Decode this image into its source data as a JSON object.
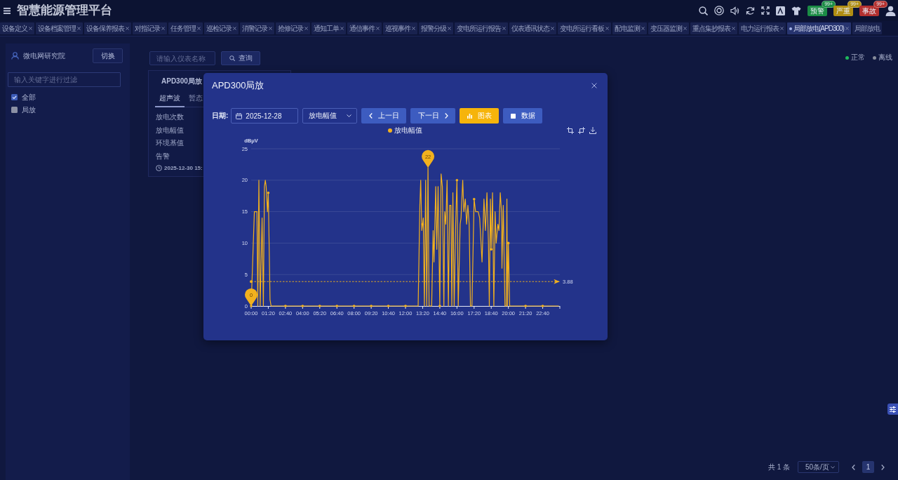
{
  "header": {
    "title": "智慧能源管理平台",
    "alerts": [
      {
        "label": "预警",
        "count": "99+",
        "color": "#1b8c45"
      },
      {
        "label": "严重",
        "count": "99+",
        "color": "#b08d12"
      },
      {
        "label": "事故",
        "count": "99+",
        "color": "#b3302f"
      }
    ]
  },
  "tabs": [
    {
      "label": "设备定义",
      "selected": false,
      "closable": true
    },
    {
      "label": "设备档案管理",
      "selected": false,
      "closable": true
    },
    {
      "label": "设备保养报表",
      "selected": false,
      "closable": true
    },
    {
      "label": "对指记录",
      "selected": false,
      "closable": true
    },
    {
      "label": "任务管理",
      "selected": false,
      "closable": true
    },
    {
      "label": "巡检记录",
      "selected": false,
      "closable": true
    },
    {
      "label": "消警记录",
      "selected": false,
      "closable": true
    },
    {
      "label": "抢修记录",
      "selected": false,
      "closable": true
    },
    {
      "label": "通知工单",
      "selected": false,
      "closable": true
    },
    {
      "label": "通信事件",
      "selected": false,
      "closable": true
    },
    {
      "label": "巡视事件",
      "selected": false,
      "closable": true
    },
    {
      "label": "报警分级",
      "selected": false,
      "closable": true
    },
    {
      "label": "变电所运行报告",
      "selected": false,
      "closable": true
    },
    {
      "label": "仪表通讯状态",
      "selected": false,
      "closable": true
    },
    {
      "label": "变电所运行看板",
      "selected": false,
      "closable": true
    },
    {
      "label": "配电监测",
      "selected": false,
      "closable": true
    },
    {
      "label": "变压器监测",
      "selected": false,
      "closable": true
    },
    {
      "label": "重点集抄报表",
      "selected": false,
      "closable": true
    },
    {
      "label": "电力运行报表",
      "selected": false,
      "closable": true
    },
    {
      "label": "局部放电(APD300)",
      "selected": true,
      "closable": true
    },
    {
      "label": "局部放电",
      "selected": false,
      "closable": false
    }
  ],
  "sidebar": {
    "organization": "微电网研究院",
    "switch_button": "切换",
    "filter": {
      "placeholder": "输入关键字进行过滤"
    },
    "items": [
      {
        "label": "全部",
        "checked": true
      },
      {
        "label": "局放",
        "checked": false
      }
    ]
  },
  "meter_search": {
    "placeholder": "请输入仪表名称",
    "button": "查询"
  },
  "status_legend": [
    {
      "label": "正常",
      "color": "#1fb85c"
    },
    {
      "label": "离线",
      "color": "#868b9a"
    }
  ],
  "device_card": {
    "title": "APD300局放",
    "tabs": [
      {
        "label": "超声波",
        "selected": true
      },
      {
        "label": "暂态",
        "selected": false
      }
    ],
    "rows": [
      "放电次数",
      "放电幅值",
      "环境基值",
      "告警"
    ],
    "time": "2025-12-30 15:"
  },
  "dialog": {
    "title": "APD300局放",
    "date_label": "日期:",
    "date": "2025-12-28",
    "metric": "放电幅值",
    "nav_buttons": [
      {
        "label": "上一日",
        "kind": "prev"
      },
      {
        "label": "下一日",
        "kind": "next"
      }
    ],
    "views": [
      {
        "label": "图表",
        "kind": "chart",
        "selected": true
      },
      {
        "label": "数据",
        "kind": "table",
        "selected": false
      }
    ],
    "chart_data": {
      "type": "line",
      "ylabel": "dBμV",
      "grid": true,
      "x": [
        0,
        15,
        27,
        31,
        36,
        42,
        51,
        57,
        62,
        66,
        70,
        76,
        80,
        88,
        93,
        160,
        240,
        320,
        400,
        480,
        560,
        640,
        720,
        779,
        787,
        791,
        796,
        800,
        803,
        808,
        814,
        819,
        825,
        830,
        842,
        849,
        853,
        861,
        866,
        872,
        880,
        886,
        892,
        899,
        903,
        908,
        914,
        920,
        926,
        932,
        936,
        941,
        947,
        954,
        960,
        966,
        975,
        979,
        987,
        992,
        999,
        1005,
        1011,
        1017,
        1023,
        1030,
        1040,
        1047,
        1059,
        1066,
        1077,
        1086,
        1093,
        1100,
        1107,
        1111,
        1116,
        1120,
        1126,
        1132,
        1138,
        1143,
        1151,
        1156,
        1162,
        1168,
        1170,
        1176,
        1184,
        1190,
        1193,
        1196,
        1200,
        1206,
        1280,
        1360,
        1435
      ],
      "series": [
        {
          "name": "放电幅值",
          "color": "#f2b11e",
          "values": [
            0,
            15,
            15,
            0,
            20,
            0,
            14,
            0,
            19,
            20,
            19,
            15,
            18,
            1,
            0,
            0,
            0,
            0,
            0,
            0,
            0,
            0,
            0,
            0,
            16,
            20,
            12,
            13,
            14,
            0,
            20,
            0,
            22,
            0,
            0,
            12,
            7,
            19,
            9,
            19,
            0,
            21,
            19,
            0,
            15,
            13,
            20,
            0,
            16,
            16,
            0,
            18,
            0,
            13,
            20,
            0,
            13,
            14,
            20,
            15,
            17,
            13,
            16,
            13,
            0,
            0,
            17,
            15,
            15,
            14,
            7,
            17,
            12,
            18,
            10,
            0,
            17,
            9,
            18,
            0,
            15,
            10,
            13,
            12,
            18,
            15,
            6,
            16,
            0,
            0,
            17,
            0,
            10,
            0,
            0,
            0,
            0
          ]
        }
      ],
      "xlim": [
        0,
        1440
      ],
      "ylim": [
        0,
        25
      ],
      "xticks": [
        {
          "value": 0,
          "label": "00:00"
        },
        {
          "value": 80,
          "label": "01:20"
        },
        {
          "value": 160,
          "label": "02:40"
        },
        {
          "value": 240,
          "label": "04:00"
        },
        {
          "value": 320,
          "label": "05:20"
        },
        {
          "value": 400,
          "label": "06:40"
        },
        {
          "value": 480,
          "label": "08:00"
        },
        {
          "value": 560,
          "label": "09:20"
        },
        {
          "value": 640,
          "label": "10:40"
        },
        {
          "value": 720,
          "label": "12:00"
        },
        {
          "value": 800,
          "label": "13:20"
        },
        {
          "value": 880,
          "label": "14:40"
        },
        {
          "value": 960,
          "label": "16:00"
        },
        {
          "value": 1040,
          "label": "17:20"
        },
        {
          "value": 1120,
          "label": "18:40"
        },
        {
          "value": 1200,
          "label": "20:00"
        },
        {
          "value": 1280,
          "label": "21:20"
        },
        {
          "value": 1360,
          "label": "22:40"
        }
      ],
      "yticks": [
        0,
        5,
        10,
        15,
        20,
        25
      ],
      "annotations": [
        {
          "text": "22",
          "x": 825,
          "y": 22
        },
        {
          "text": "0",
          "x": 0,
          "y": 0
        }
      ],
      "ref_lines": [
        {
          "axis": "y",
          "value": 3.88,
          "label": "3.88"
        }
      ]
    }
  },
  "pagination": {
    "total": "共 1 条",
    "page_size": "50条/页",
    "pages": [
      {
        "label": "1",
        "selected": true
      }
    ]
  }
}
